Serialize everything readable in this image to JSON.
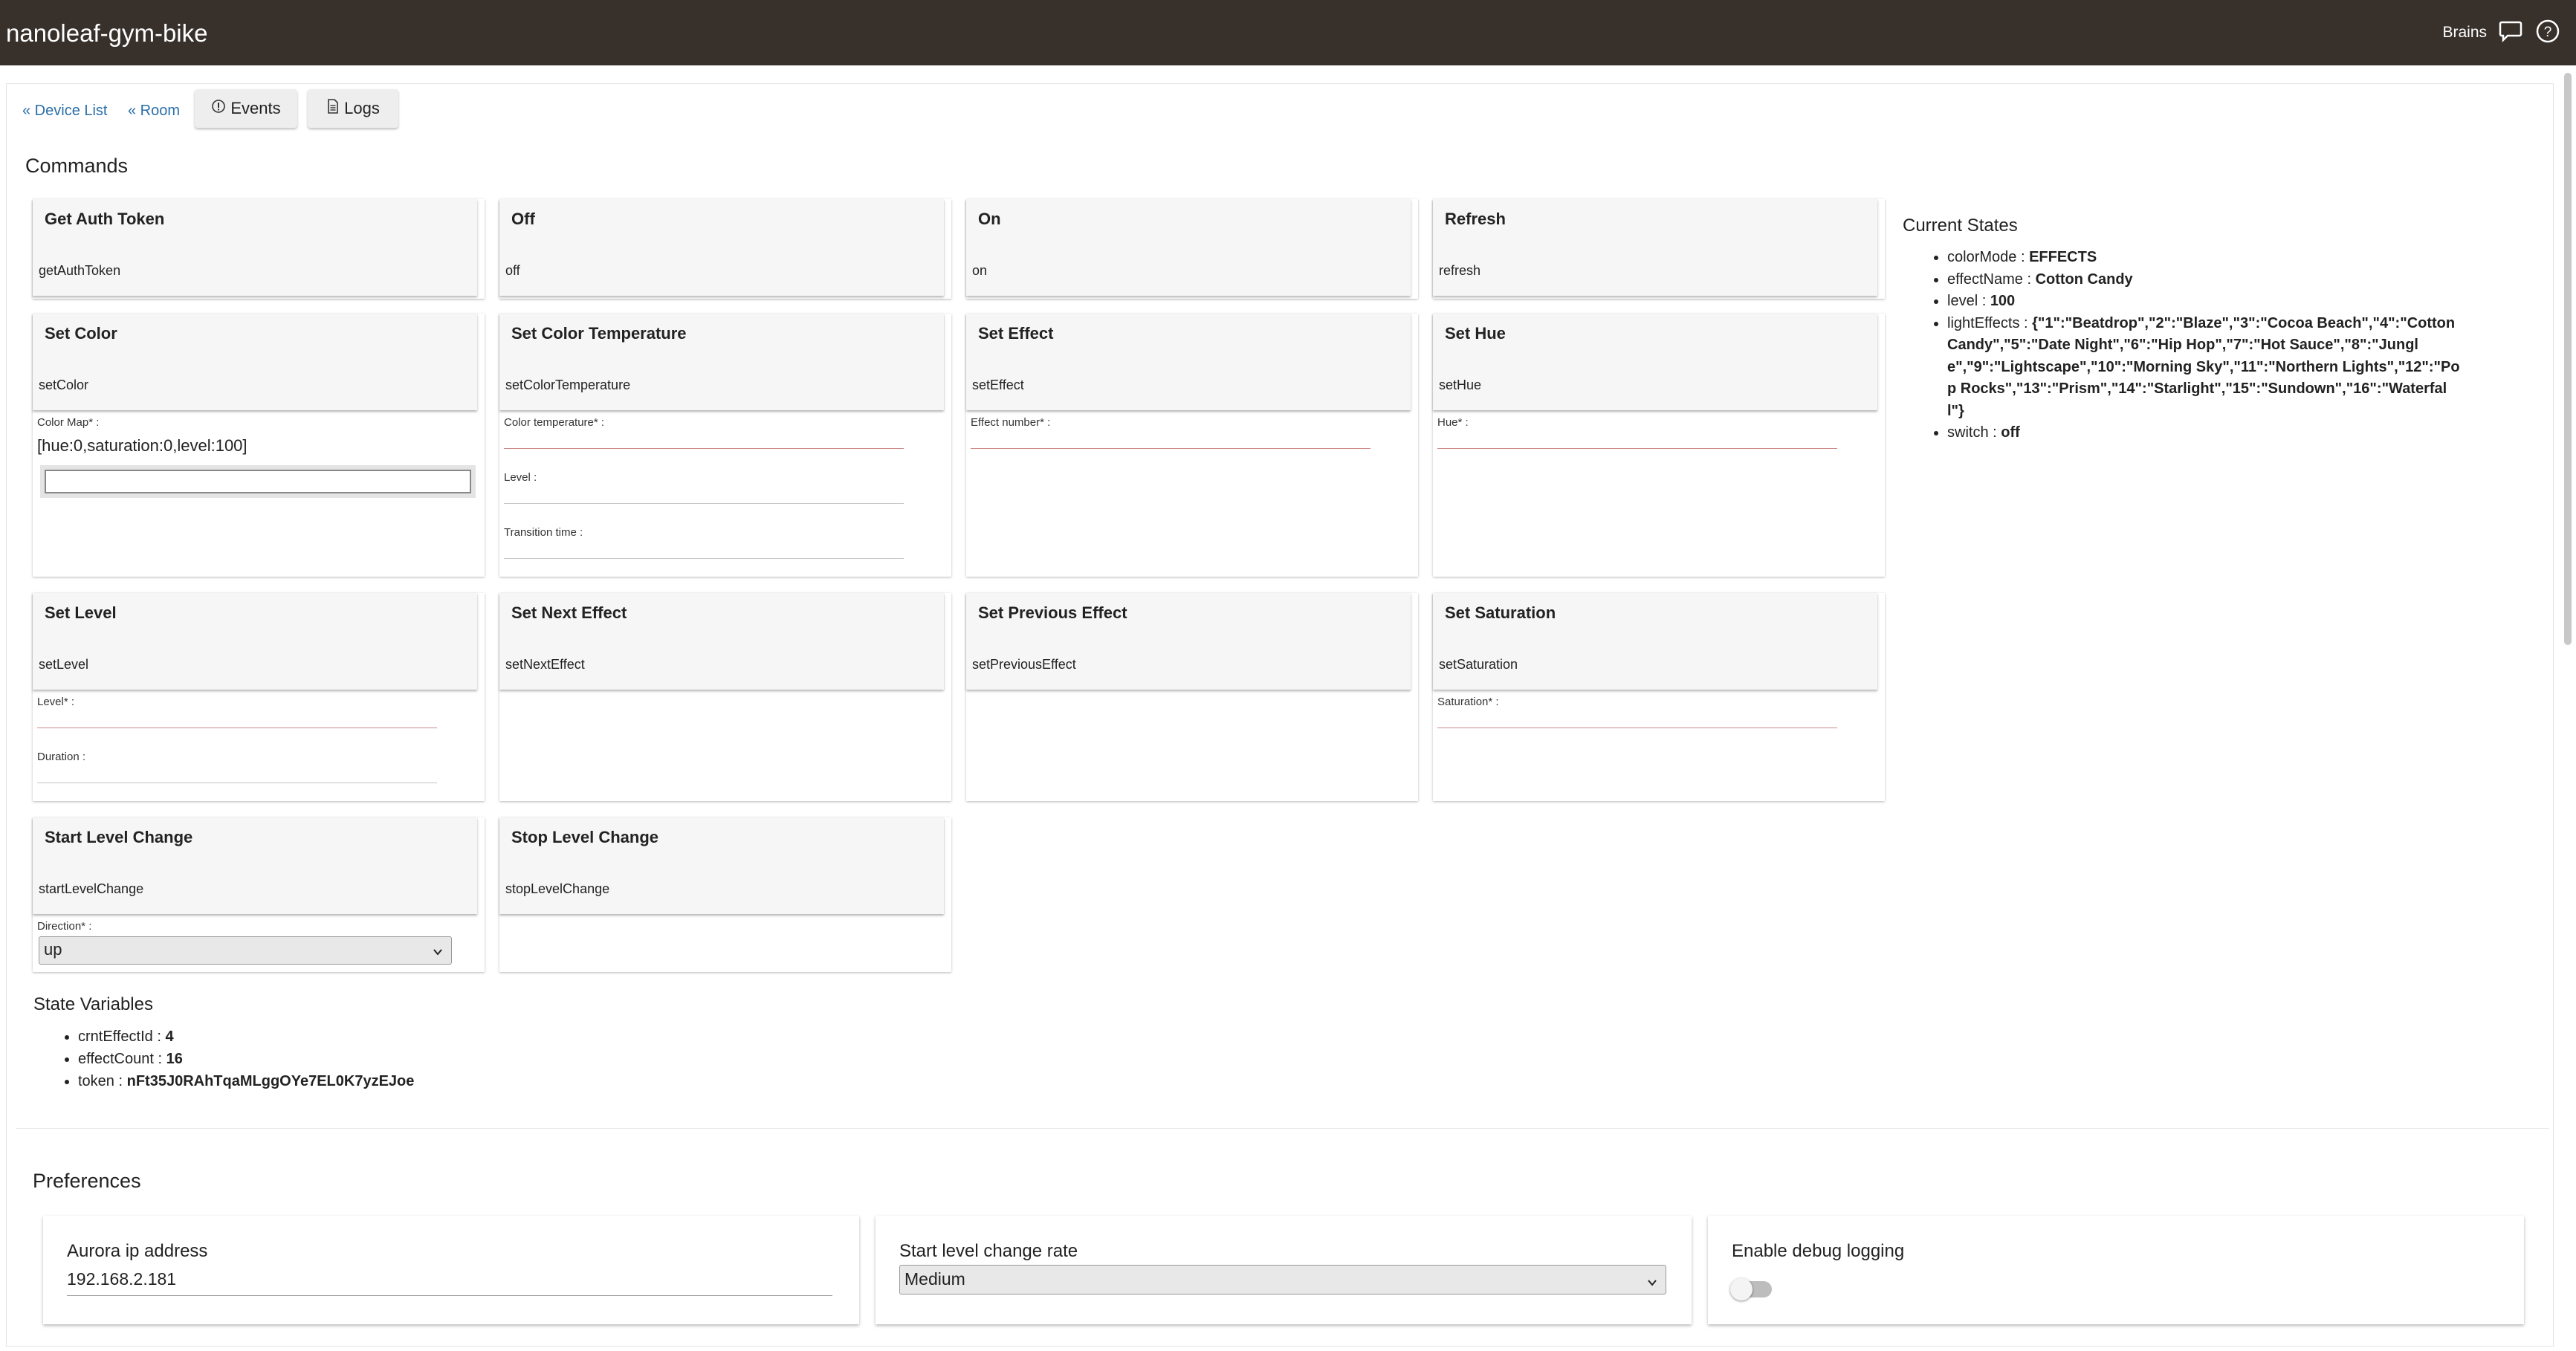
{
  "header": {
    "title": "nanoleaf-gym-bike",
    "user": "Brains",
    "chat_icon": "chat-bubble-icon",
    "help_icon": "help-circle-icon"
  },
  "nav": {
    "device_list": "« Device List",
    "room": "« Room",
    "events": "Events",
    "logs": "Logs"
  },
  "commands": {
    "heading": "Commands",
    "cards": {
      "get_auth_token": {
        "name": "Get Auth Token",
        "method": "getAuthToken"
      },
      "off": {
        "name": "Off",
        "method": "off"
      },
      "on": {
        "name": "On",
        "method": "on"
      },
      "refresh": {
        "name": "Refresh",
        "method": "refresh"
      },
      "set_color": {
        "name": "Set Color",
        "method": "setColor",
        "field_label": "Color Map* :",
        "field_value": "[hue:0,saturation:0,level:100]"
      },
      "set_color_temperature": {
        "name": "Set Color Temperature",
        "method": "setColorTemperature",
        "field1": "Color temperature* :",
        "field2": "Level :",
        "field3": "Transition time :"
      },
      "set_effect": {
        "name": "Set Effect",
        "method": "setEffect",
        "field1": "Effect number* :"
      },
      "set_hue": {
        "name": "Set Hue",
        "method": "setHue",
        "field1": "Hue* :"
      },
      "set_level": {
        "name": "Set Level",
        "method": "setLevel",
        "field1": "Level* :",
        "field2": "Duration :"
      },
      "set_next_effect": {
        "name": "Set Next Effect",
        "method": "setNextEffect"
      },
      "set_previous_effect": {
        "name": "Set Previous Effect",
        "method": "setPreviousEffect"
      },
      "set_saturation": {
        "name": "Set Saturation",
        "method": "setSaturation",
        "field1": "Saturation* :"
      },
      "start_level_change": {
        "name": "Start Level Change",
        "method": "startLevelChange",
        "field1": "Direction* :",
        "direction_value": "up"
      },
      "stop_level_change": {
        "name": "Stop Level Change",
        "method": "stopLevelChange"
      }
    }
  },
  "current_states": {
    "heading": "Current States",
    "items": [
      {
        "key": "colorMode",
        "value": "EFFECTS"
      },
      {
        "key": "effectName",
        "value": "Cotton Candy"
      },
      {
        "key": "level",
        "value": "100"
      },
      {
        "key": "lightEffects",
        "value": "{\"1\":\"Beatdrop\",\"2\":\"Blaze\",\"3\":\"Cocoa Beach\",\"4\":\"Cotton Candy\",\"5\":\"Date Night\",\"6\":\"Hip Hop\",\"7\":\"Hot Sauce\",\"8\":\"Jungle\",\"9\":\"Lightscape\",\"10\":\"Morning Sky\",\"11\":\"Northern Lights\",\"12\":\"Pop Rocks\",\"13\":\"Prism\",\"14\":\"Starlight\",\"15\":\"Sundown\",\"16\":\"Waterfall\"}"
      },
      {
        "key": "switch",
        "value": "off"
      }
    ]
  },
  "state_variables": {
    "heading": "State Variables",
    "items": [
      {
        "key": "crntEffectId",
        "value": "4"
      },
      {
        "key": "effectCount",
        "value": "16"
      },
      {
        "key": "token",
        "value": "nFt35J0RAhTqaMLggOYe7EL0K7yzEJoe"
      }
    ]
  },
  "preferences": {
    "heading": "Preferences",
    "aurora_ip": {
      "label": "Aurora ip address",
      "value": "192.168.2.181"
    },
    "level_rate": {
      "label": "Start level change rate",
      "value": "Medium"
    },
    "debug": {
      "label": "Enable debug logging",
      "enabled": false
    }
  }
}
